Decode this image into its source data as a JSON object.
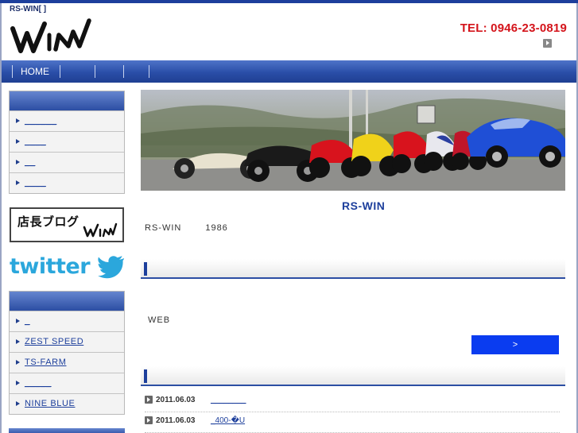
{
  "header": {
    "site_tag": "RS-WIN[                              ]",
    "logo_text": "win",
    "tel": "TEL: 0946-23-0819",
    "tel_arrow_icon": "play-arrow-icon"
  },
  "nav": {
    "items": [
      "HOME",
      "",
      "",
      "",
      ""
    ]
  },
  "sidebar": {
    "menu1": [
      "______",
      "____",
      "__",
      "____"
    ],
    "blog_banner_text": "店長ブログ",
    "blog_banner_logo": "win",
    "twitter_text": "twitter",
    "links": [
      "_",
      "ZEST SPEED",
      "TS-FARM",
      "_____",
      "NINE BLUE"
    ]
  },
  "main": {
    "shop_name": "RS-WIN",
    "intro_name": "RS-WIN",
    "intro_year": "1986",
    "web_text": "WEB",
    "more_button": ">",
    "news": [
      {
        "date": "2011.06.03",
        "title": "________"
      },
      {
        "date": "2011.06.03",
        "title": "_400-�U"
      }
    ]
  },
  "colors": {
    "brand_blue": "#1d3f9c",
    "tel_red": "#d4141b",
    "button_blue": "#0a3cf0",
    "twitter_blue": "#2ba7dc"
  }
}
